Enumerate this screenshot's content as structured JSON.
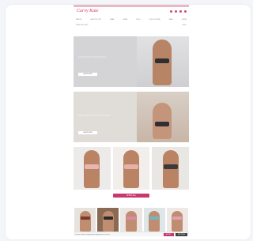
{
  "brand": {
    "logo_text": "Curvy Kate",
    "accent": "#d23a73",
    "topbar_color": "#e8b8c3"
  },
  "header": {
    "icons": [
      "search-icon",
      "user-icon",
      "heart-icon",
      "bag-icon"
    ],
    "nav": [
      "NEW IN",
      "SHOP BY CUP",
      "BRAS",
      "SWIM",
      "PLUS",
      "COLLECTIONS",
      "SALE",
      "MORE"
    ],
    "util_left": "FREE DELIVERY",
    "util_right": "HELP"
  },
  "hero1": {
    "headline": "EVERYDAY ESSENTIALS",
    "button": "SHOP NOW"
  },
  "hero2": {
    "headline": "NEW SEASON COLLECTION",
    "button": "SHOP NOW"
  },
  "tiles": [
    {
      "label": "",
      "set_color": "#e8b6b2"
    },
    {
      "label": "",
      "set_color": "#e5b1a8"
    },
    {
      "label": "",
      "set_color": "#3a3a3a"
    }
  ],
  "shop_all": "SHOP ALL",
  "products": [
    {
      "bra_color": "#7a3b2a"
    },
    {
      "bra_color": "#2b2b2b"
    },
    {
      "bra_color": "#d98aa6"
    },
    {
      "bra_color": "#6fb7c6"
    },
    {
      "bra_color": "#e0a2b2"
    }
  ],
  "cookie": {
    "text": "We use cookies to improve your experience on our site.",
    "accept": "ACCEPT",
    "settings": "SETTINGS"
  }
}
